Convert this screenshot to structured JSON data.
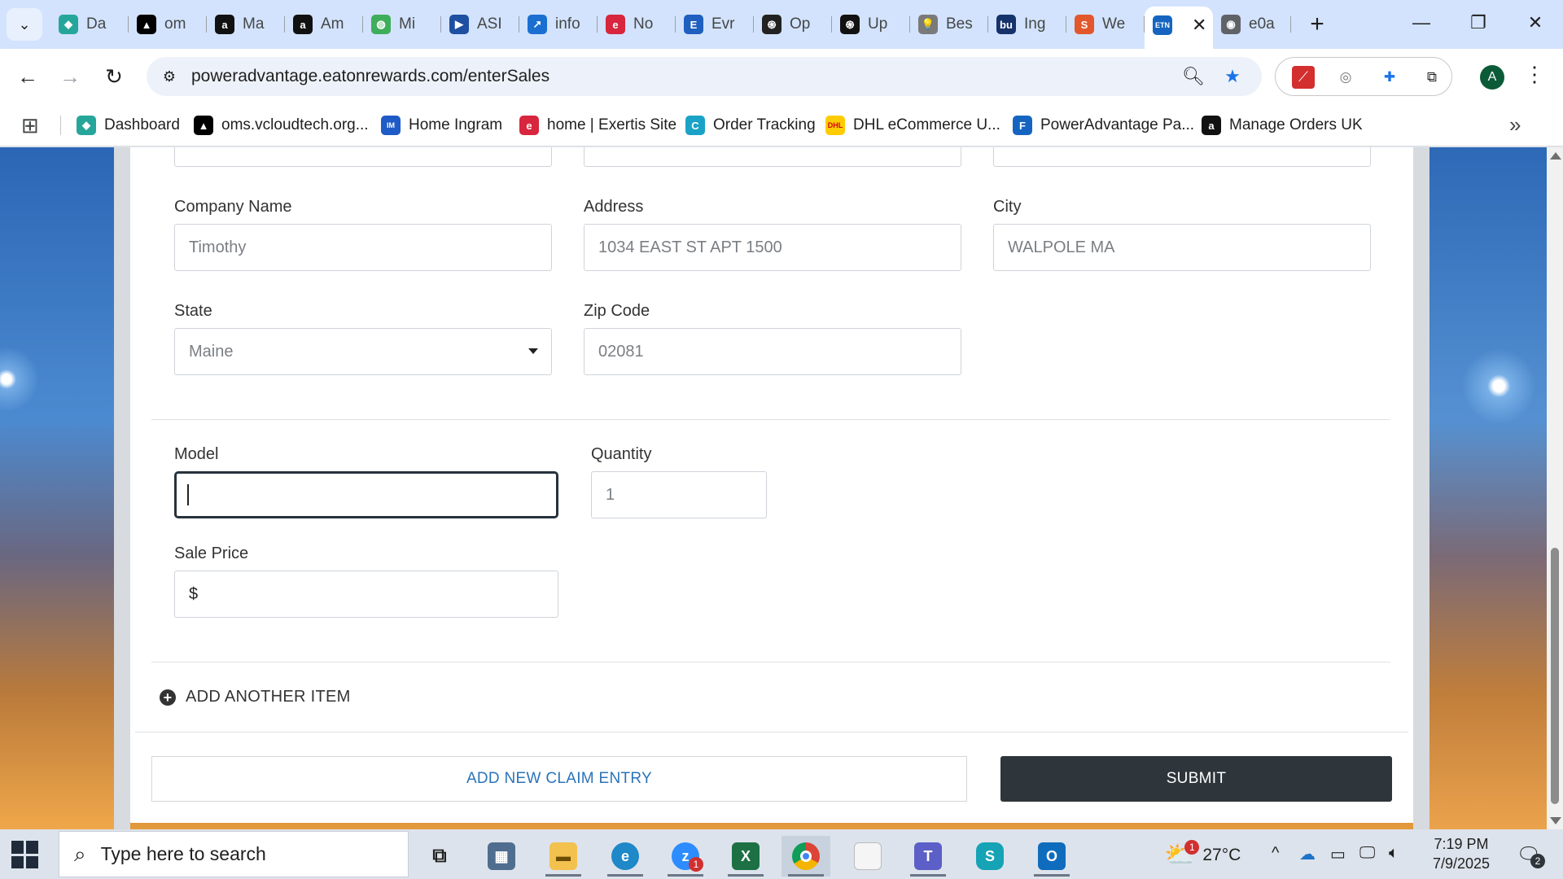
{
  "browser": {
    "tabs": [
      {
        "title": "Da",
        "icon": "dashboard-favicon",
        "color": "#26a69a",
        "glyph": "◆"
      },
      {
        "title": "om",
        "icon": "oms-favicon",
        "color": "#000000",
        "glyph": "▲"
      },
      {
        "title": "Ma",
        "icon": "amazon-favicon",
        "color": "#111111",
        "glyph": "a"
      },
      {
        "title": "Am",
        "icon": "amazon-favicon",
        "color": "#111111",
        "glyph": "a"
      },
      {
        "title": "Mi",
        "icon": "mint-favicon",
        "color": "#3fae5a",
        "glyph": "◍"
      },
      {
        "title": "ASI",
        "icon": "asi-favicon",
        "color": "#1e4fa1",
        "glyph": "▶"
      },
      {
        "title": "info",
        "icon": "info-favicon",
        "color": "#1b6fd1",
        "glyph": "↗"
      },
      {
        "title": "No",
        "icon": "exertis-favicon",
        "color": "#d7263d",
        "glyph": "e"
      },
      {
        "title": "Evr",
        "icon": "evr-favicon",
        "color": "#1f5fbf",
        "glyph": "E"
      },
      {
        "title": "Op",
        "icon": "openai-favicon",
        "color": "#222222",
        "glyph": "֍"
      },
      {
        "title": "Up",
        "icon": "openai-favicon",
        "color": "#111111",
        "glyph": "֍"
      },
      {
        "title": "Bes",
        "icon": "lightbulb-favicon",
        "color": "#7a7a7a",
        "glyph": "💡"
      },
      {
        "title": "Ing",
        "icon": "bu-favicon",
        "color": "#16326b",
        "glyph": "bu"
      },
      {
        "title": "We",
        "icon": "we-favicon",
        "color": "#e2572b",
        "glyph": "S"
      },
      {
        "title": "",
        "icon": "eaton-favicon",
        "color": "#1565c0",
        "glyph": "ETN",
        "active": true
      },
      {
        "title": "e0a",
        "icon": "globe-favicon",
        "color": "#5f6368",
        "glyph": "◉"
      }
    ],
    "url": "poweradvantage.eatonrewards.com/enterSales",
    "avatar_letter": "A"
  },
  "bookmarks": [
    {
      "label": "Dashboard",
      "color": "#26a69a",
      "glyph": "◆"
    },
    {
      "label": "oms.vcloudtech.org...",
      "color": "#000000",
      "glyph": "▲"
    },
    {
      "label": "Home Ingram",
      "color": "#1e5bc6",
      "glyph": "IM"
    },
    {
      "label": "home | Exertis Site",
      "color": "#d7263d",
      "glyph": "e"
    },
    {
      "label": "Order Tracking",
      "color": "#1aa3c7",
      "glyph": "C"
    },
    {
      "label": "DHL eCommerce U...",
      "color": "#ffcc00",
      "glyph": "DHL"
    },
    {
      "label": "PowerAdvantage Pa...",
      "color": "#1565c0",
      "glyph": "F"
    },
    {
      "label": "Manage Orders UK",
      "color": "#111111",
      "glyph": "a"
    }
  ],
  "form": {
    "company_name": {
      "label": "Company Name",
      "value": "Timothy"
    },
    "address": {
      "label": "Address",
      "value": "1034 EAST ST APT 1500"
    },
    "city": {
      "label": "City",
      "value": "WALPOLE MA"
    },
    "state": {
      "label": "State",
      "value": "Maine"
    },
    "zip": {
      "label": "Zip Code",
      "value": "02081"
    },
    "model": {
      "label": "Model",
      "value": ""
    },
    "quantity": {
      "label": "Quantity",
      "value": "1"
    },
    "sale_price": {
      "label": "Sale Price",
      "prefix": "$",
      "value": ""
    },
    "add_item_label": "ADD ANOTHER ITEM",
    "add_claim_label": "ADD NEW CLAIM ENTRY",
    "submit_label": "SUBMIT"
  },
  "taskbar": {
    "search_placeholder": "Type here to search",
    "weather_temp": "27°C",
    "weather_badge": "1",
    "time": "7:19 PM",
    "date": "7/9/2025",
    "notification_count": "2",
    "zoom_badge": "1"
  },
  "colors": {
    "submit_bg": "#2e353b",
    "link_blue": "#2b74b8",
    "focus_border": "#26323d"
  }
}
